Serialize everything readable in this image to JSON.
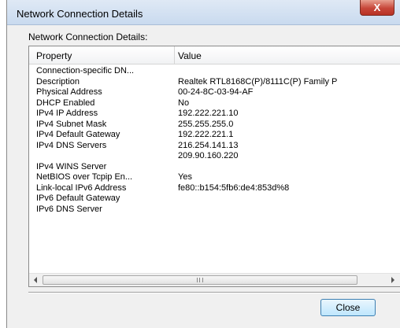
{
  "window": {
    "title": "Network Connection Details",
    "close_glyph": "X"
  },
  "group_label": "Network Connection Details:",
  "columns": [
    "Property",
    "Value"
  ],
  "rows": [
    {
      "property": "Connection-specific DN...",
      "value": ""
    },
    {
      "property": "Description",
      "value": "Realtek RTL8168C(P)/8111C(P) Family P"
    },
    {
      "property": "Physical Address",
      "value": "00-24-8C-03-94-AF"
    },
    {
      "property": "DHCP Enabled",
      "value": "No"
    },
    {
      "property": "IPv4 IP Address",
      "value": "192.222.221.10"
    },
    {
      "property": "IPv4 Subnet Mask",
      "value": "255.255.255.0"
    },
    {
      "property": "IPv4 Default Gateway",
      "value": "192.222.221.1"
    },
    {
      "property": "IPv4 DNS Servers",
      "value": "216.254.141.13"
    },
    {
      "property": "",
      "value": "209.90.160.220"
    },
    {
      "property": "IPv4 WINS Server",
      "value": ""
    },
    {
      "property": "NetBIOS over Tcpip En...",
      "value": "Yes"
    },
    {
      "property": "Link-local IPv6 Address",
      "value": "fe80::b154:5fb6:de4:853d%8"
    },
    {
      "property": "IPv6 Default Gateway",
      "value": ""
    },
    {
      "property": "IPv6 DNS Server",
      "value": ""
    }
  ],
  "scrollbar": {
    "grip_label": "III"
  },
  "buttons": {
    "close_label": "Close"
  },
  "icons": {
    "close": "close-icon",
    "scroll_left": "chevron-left-icon",
    "scroll_right": "chevron-right-icon"
  }
}
